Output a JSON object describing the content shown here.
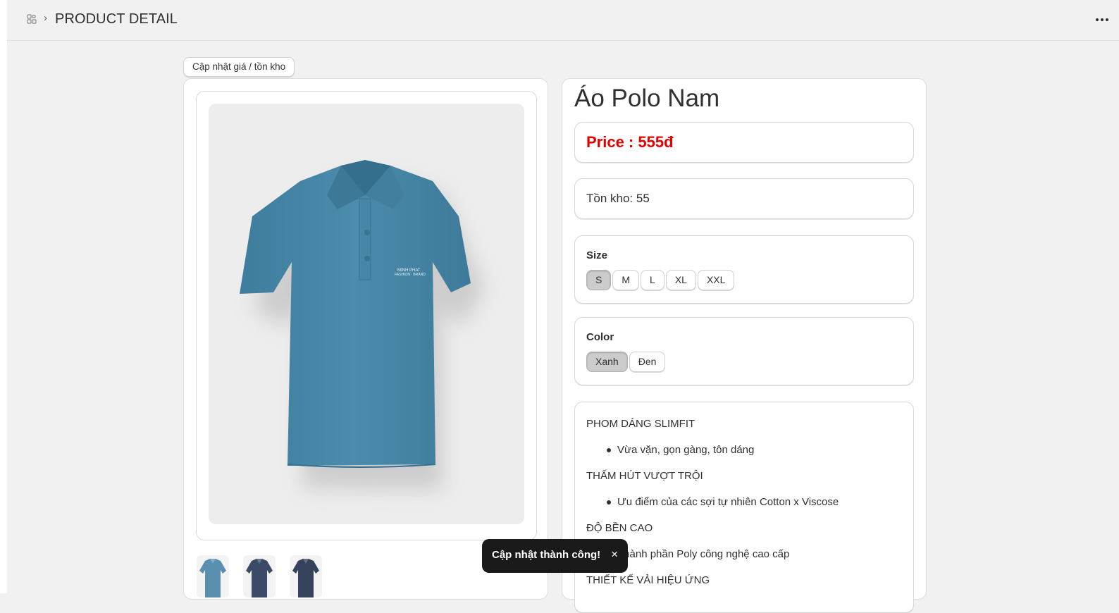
{
  "header": {
    "title": "PRODUCT DETAIL",
    "chevron": "›"
  },
  "actions": {
    "update_label": "Cập nhật giá / tồn kho"
  },
  "product": {
    "name": "Áo Polo Nam",
    "price_text": "Price : 555đ",
    "stock_text": "Tồn kho: 55",
    "image_color": "#4a89a8"
  },
  "size": {
    "label": "Size",
    "options": [
      "S",
      "M",
      "L",
      "XL",
      "XXL"
    ],
    "selected": "S"
  },
  "color": {
    "label": "Color",
    "options": [
      "Xanh",
      "Đen"
    ],
    "selected": "Xanh"
  },
  "description": [
    {
      "type": "heading",
      "text": "PHOM DÁNG SLIMFIT"
    },
    {
      "type": "item",
      "text": "Vừa vặn, gọn gàng, tôn dáng"
    },
    {
      "type": "heading",
      "text": "THẤM HÚT VƯỢT TRỘI"
    },
    {
      "type": "item",
      "text": "Ưu điểm của các sợi tự nhiên Cotton x Viscose"
    },
    {
      "type": "heading",
      "text": "ĐỘ BỀN CAO"
    },
    {
      "type": "item",
      "text": "Thành phần Poly công nghệ cao cấp"
    },
    {
      "type": "heading",
      "text": "THIẾT KẾ VẢI HIỆU ỨNG"
    }
  ],
  "thumbnails": [
    {
      "name": "thumbnail-blue",
      "color": "#5a8fb0"
    },
    {
      "name": "thumbnail-navy",
      "color": "#3b4a66"
    },
    {
      "name": "thumbnail-dark-navy",
      "color": "#34425c"
    }
  ],
  "toast": {
    "message": "Cập nhật thành công!",
    "close": "×"
  },
  "colors": {
    "price_red": "#e50000",
    "selected_bg": "#cccccc",
    "toast_bg": "#1a1a1a"
  },
  "icons": [
    "apps-icon",
    "chevron-right-icon",
    "more-horizontal-icon",
    "close-icon"
  ]
}
